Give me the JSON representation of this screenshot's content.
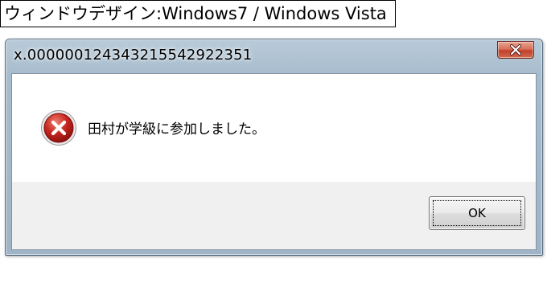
{
  "caption": "ウィンドウデザイン:Windows7 / Windows Vista",
  "dialog": {
    "title": "x.000000124343215542922351",
    "message": "田村が学級に参加しました。",
    "icon": "error-icon",
    "ok_label": "OK",
    "close_icon": "close-icon"
  },
  "colors": {
    "close_button": "#c7432e",
    "error_icon": "#c0221e",
    "frame": "#a7bccd"
  }
}
